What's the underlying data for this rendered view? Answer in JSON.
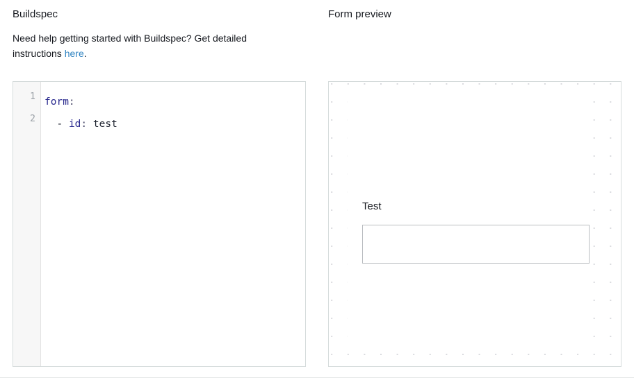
{
  "buildspec": {
    "title": "Buildspec",
    "help_text_before": "Need help getting started with Buildspec? Get detailed instructions ",
    "help_link_label": "here",
    "help_text_after": ".",
    "editor": {
      "line_numbers": [
        "1",
        "2"
      ],
      "lines": [
        {
          "indent": "",
          "key": "form",
          "colon": ":",
          "dash": "",
          "value": ""
        },
        {
          "indent": "  ",
          "key": "id",
          "colon": ":",
          "dash": "- ",
          "value": "test"
        }
      ],
      "raw": "form:\n  - id: test"
    }
  },
  "form_preview": {
    "title": "Form preview",
    "fields": [
      {
        "label": "Test",
        "value": "",
        "placeholder": ""
      }
    ]
  },
  "colors": {
    "text": "#16191f",
    "link": "#3184c2",
    "panel_border": "#d5dbdb",
    "gutter_bg": "#f7f7f7",
    "gutter_text": "#9aa0a6",
    "code_key": "#2b2b8f",
    "code_value": "#1f2430",
    "grid_dot": "#d9dade",
    "input_border": "#b9bcc0"
  }
}
